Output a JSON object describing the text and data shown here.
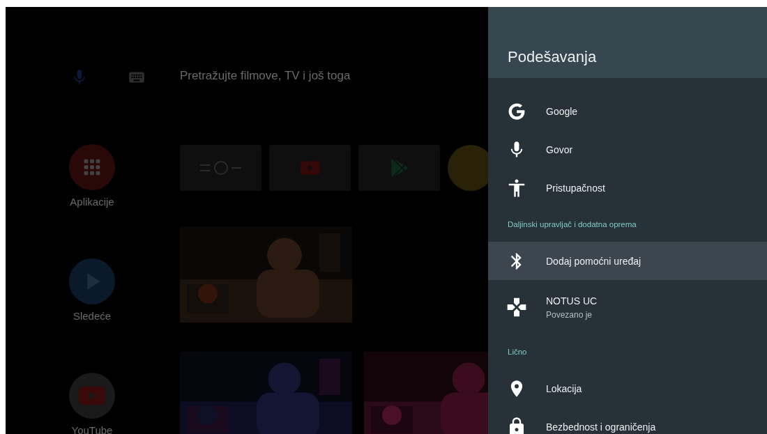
{
  "home": {
    "search": {
      "placeholder": "Pretražujte filmove, TV i još toga"
    },
    "nav": [
      {
        "kind": "apps",
        "label": "Aplikacije"
      },
      {
        "kind": "play",
        "label": "Sledeće"
      },
      {
        "kind": "youtube",
        "label": "YouTube"
      }
    ],
    "tiles": [
      {
        "kind": "tv"
      },
      {
        "kind": "youtube"
      },
      {
        "kind": "store"
      },
      {
        "kind": "partial"
      }
    ]
  },
  "settings": {
    "title": "Podešavanja",
    "items": [
      {
        "kind": "item",
        "label": "Google",
        "selected": false
      },
      {
        "kind": "item",
        "label": "Govor",
        "selected": false
      },
      {
        "kind": "item",
        "label": "Pristupačnost",
        "selected": false
      },
      {
        "kind": "section",
        "label": "Daljinski upravljač i dodatna oprema"
      },
      {
        "kind": "item",
        "label": "Dodaj pomoćni uređaj",
        "selected": true
      },
      {
        "kind": "item",
        "label": "NOTUS UC",
        "sublabel": "Povezano je",
        "selected": false
      },
      {
        "kind": "section",
        "label": "Lično"
      },
      {
        "kind": "item",
        "label": "Lokacija",
        "selected": false
      },
      {
        "kind": "item",
        "label": "Bezbednost i ograničenja",
        "selected": false
      }
    ]
  }
}
